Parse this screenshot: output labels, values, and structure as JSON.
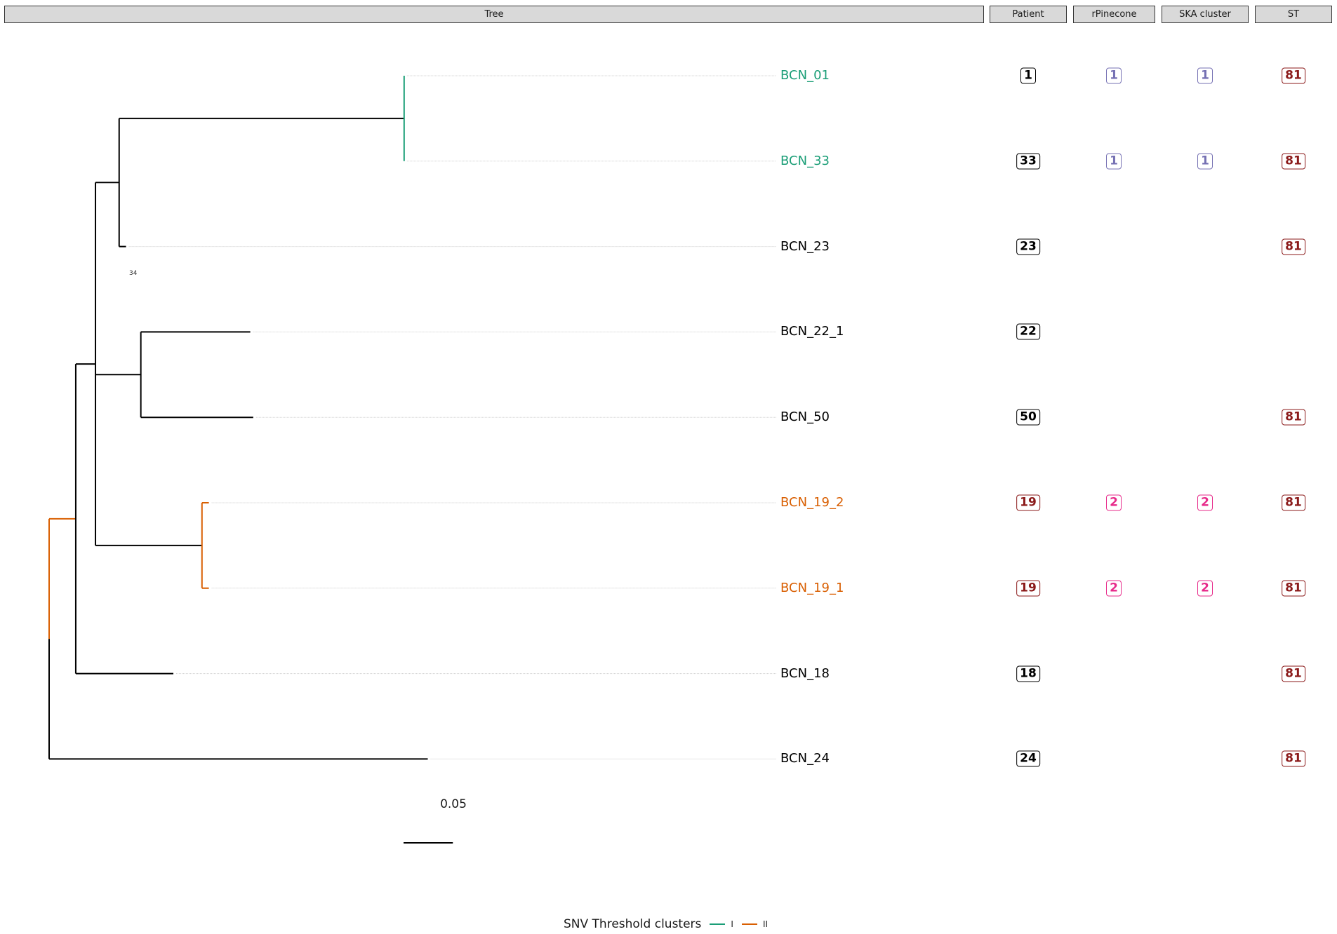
{
  "panels": {
    "tree": "Tree",
    "patient": "Patient",
    "rpinecone": "rPinecone",
    "ska": "SKA cluster",
    "st": "ST"
  },
  "colors": {
    "cluster_I": "#1b9e77",
    "cluster_II": "#d95f02",
    "default_tip": "#000000",
    "patient_default": "#000000",
    "patient_19": "#8b1a1a",
    "cluster_1_badge": "#7570b3",
    "cluster_2_badge": "#e7298a",
    "st_badge": "#8b1a1a"
  },
  "tips": [
    {
      "label": "BCN_01",
      "cluster": "I",
      "patient": "1",
      "rpinecone": "1",
      "ska": "1",
      "st": "81"
    },
    {
      "label": "BCN_33",
      "cluster": "I",
      "patient": "33",
      "rpinecone": "1",
      "ska": "1",
      "st": "81"
    },
    {
      "label": "BCN_23",
      "cluster": "",
      "patient": "23",
      "rpinecone": "",
      "ska": "",
      "st": "81"
    },
    {
      "label": "BCN_22_1",
      "cluster": "",
      "patient": "22",
      "rpinecone": "",
      "ska": "",
      "st": ""
    },
    {
      "label": "BCN_50",
      "cluster": "",
      "patient": "50",
      "rpinecone": "",
      "ska": "",
      "st": "81"
    },
    {
      "label": "BCN_19_2",
      "cluster": "II",
      "patient": "19",
      "rpinecone": "2",
      "ska": "2",
      "st": "81"
    },
    {
      "label": "BCN_19_1",
      "cluster": "II",
      "patient": "19",
      "rpinecone": "2",
      "ska": "2",
      "st": "81"
    },
    {
      "label": "BCN_18",
      "cluster": "",
      "patient": "18",
      "rpinecone": "",
      "ska": "",
      "st": "81"
    },
    {
      "label": "BCN_24",
      "cluster": "",
      "patient": "24",
      "rpinecone": "",
      "ska": "",
      "st": "81"
    }
  ],
  "tree": {
    "branch_lengths": {
      "root_to_nodeA": 0.027,
      "root_to_BCN_24": 0.384,
      "nodeA_to_nodeB": 0.02,
      "nodeA_to_BCN_18": 0.099,
      "nodeB_to_nodeC": 0.024,
      "nodeB_to_nodeE": 0.046,
      "nodeB_to_nodeF": 0.108,
      "nodeC_to_nodeD": 0.289,
      "nodeC_to_BCN_23": 0.007,
      "nodeD_to_BCN_01": 0.0,
      "nodeD_to_BCN_33": 0.0,
      "nodeE_to_BCN_22_1": 0.111,
      "nodeE_to_BCN_50": 0.114,
      "nodeF_to_BCN_19_2": 0.007,
      "nodeF_to_BCN_19_1": 0.007
    },
    "support_label": "34",
    "scale_bar": {
      "length": 0.05,
      "label": "0.05"
    }
  },
  "legend": {
    "title": "SNV Threshold clusters",
    "keys": [
      {
        "label": "I",
        "cluster": "I"
      },
      {
        "label": "II",
        "cluster": "II"
      }
    ]
  }
}
